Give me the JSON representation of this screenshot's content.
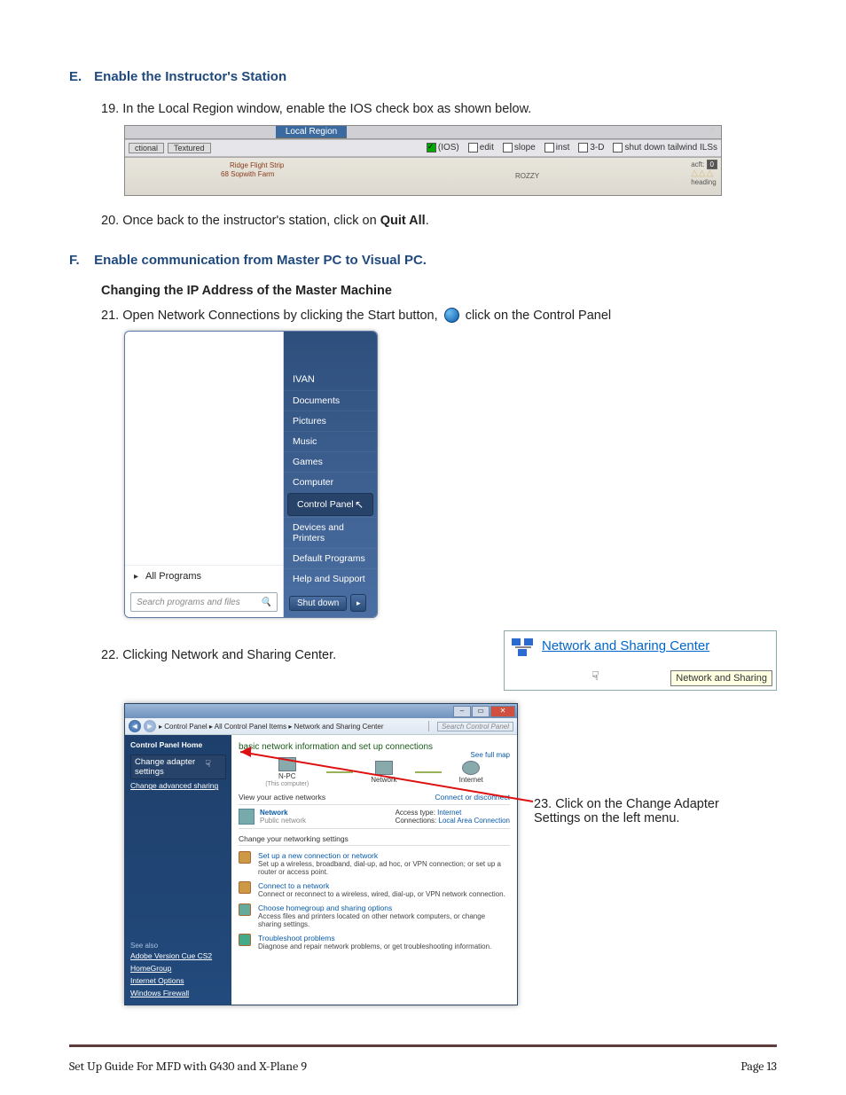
{
  "sectionE": {
    "letter": "E.",
    "title": "Enable the Instructor's Station"
  },
  "step19": {
    "num": "19.",
    "text": "In the Local Region window, enable the IOS check box as shown below."
  },
  "local_region": {
    "title": "Local Region",
    "tabs": {
      "sectional": "ctional",
      "textured": "Textured"
    },
    "checks": {
      "ios": "(IOS)",
      "edit": "edit",
      "slope": "slope",
      "inst": "inst",
      "three_d": "3-D",
      "shutdown": "shut down tailwind ILSs"
    },
    "map_labels": {
      "ridge": "Ridge Flight Strip",
      "farm": "68   Sopwith Farm",
      "rozzy": "ROZZY",
      "acft": "acft:",
      "heading": "heading"
    }
  },
  "step20": {
    "num": "20.",
    "pre": "Once back to the instructor's station, click on ",
    "bold": "Quit All",
    "post": "."
  },
  "sectionF": {
    "letter": "F.",
    "title": "Enable communication from Master PC to Visual PC."
  },
  "subheading": "Changing the IP Address of the Master Machine",
  "step21": {
    "num": "21.",
    "pre": "Open Network Connections by clicking the Start button,",
    "post": " click on the Control Panel"
  },
  "start_menu": {
    "user": "IVAN",
    "items": {
      "documents": "Documents",
      "pictures": "Pictures",
      "music": "Music",
      "games": "Games",
      "computer": "Computer",
      "control_panel": "Control Panel",
      "devices": "Devices and Printers",
      "defaults": "Default Programs",
      "help": "Help and Support"
    },
    "all_programs": "All Programs",
    "search_placeholder": "Search programs and files",
    "shutdown": "Shut down"
  },
  "step22": {
    "num": "22.",
    "text": "Clicking Network and Sharing Center."
  },
  "nws_box": {
    "link": "Network and Sharing Center",
    "tooltip": "Network and Sharing"
  },
  "nsc": {
    "path": "▸ Control Panel ▸ All Control Panel Items ▸ Network and Sharing Center",
    "search_ph": "Search Control Panel",
    "side": {
      "home": "Control Panel Home",
      "change_adapter": "Change adapter settings",
      "change_adv": "Change advanced sharing",
      "see_also": "See also",
      "links": {
        "adobe": "Adobe Version Cue CS2",
        "hg": "HomeGroup",
        "io": "Internet Options",
        "wf": "Windows Firewall"
      }
    },
    "main": {
      "h1": "basic network information and set up connections",
      "see_full_map": "See full map",
      "topo": {
        "pc": "N-PC",
        "pc2": "(This computer)",
        "net": "Network",
        "inet": "Internet"
      },
      "view_active": "View your active networks",
      "conn_disc": "Connect or disconnect",
      "net_name": "Network",
      "net_type": "Public network",
      "access_lbl": "Access type:",
      "access_val": "Internet",
      "conn_lbl": "Connections:",
      "conn_val": "Local Area Connection",
      "change_net": "Change your networking settings",
      "t1": "Set up a new connection or network",
      "t1d": "Set up a wireless, broadband, dial-up, ad hoc, or VPN connection; or set up a router or access point.",
      "t2": "Connect to a network",
      "t2d": "Connect or reconnect to a wireless, wired, dial-up, or VPN network connection.",
      "t3": "Choose homegroup and sharing options",
      "t3d": "Access files and printers located on other network computers, or change sharing settings.",
      "t4": "Troubleshoot problems",
      "t4d": "Diagnose and repair network problems, or get troubleshooting information."
    }
  },
  "step23": {
    "num": "23.",
    "text": "Click on the Change Adapter Settings on the left menu."
  },
  "footer": {
    "left": "Set Up Guide For MFD with G430 and X-Plane 9",
    "right": "Page 13"
  }
}
